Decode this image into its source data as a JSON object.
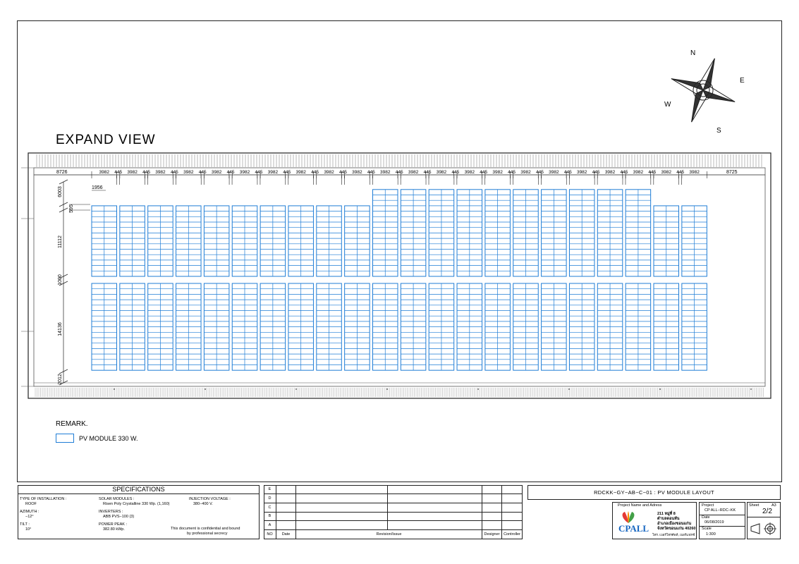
{
  "view_title": "EXPAND VIEW",
  "compass": {
    "n": "N",
    "e": "E",
    "s": "S",
    "w": "W"
  },
  "top_dims": {
    "edge_left": "8726",
    "edge_right": "8725",
    "row_width": "3982",
    "gap": "445",
    "row_count": 22
  },
  "left_dims": {
    "d1": "6003",
    "d2": "595",
    "d3": "11112",
    "d4": "1000",
    "d5": "14136",
    "d6": "2012",
    "module_width": "1956"
  },
  "layout": {
    "upper_tall_rows": [
      10,
      11,
      12,
      13,
      14,
      15,
      16,
      17,
      18,
      19
    ],
    "upper_rows_normal": 13,
    "upper_rows_tall": 16,
    "lower_rows": 16
  },
  "colors": {
    "module": "#1f7dd6",
    "line": "#222222"
  },
  "remark": {
    "title": "REMARK.",
    "legend_label": "PV MODULE 330 W."
  },
  "specs": {
    "heading": "SPECIFICATIONS",
    "type_label": "TYPE OF INSTALLATION :",
    "type_value": "ROOF",
    "azimuth_label": "AZIMUTH :",
    "azimuth_value": "−12°",
    "tilt_label": "TILT :",
    "tilt_value": "10°",
    "modules_label": "SOLAR MODULES :",
    "modules_value": "Risen Poly Crystalline 330 Wp. (1,160)",
    "inverters_label": "INVERTERS :",
    "inverters_value": "ABB PVS−100 (3)",
    "peak_label": "POWER PEAK :",
    "peak_value": "382.80 kWp.",
    "injection_label": "INJECTION VOLTAGE :",
    "injection_value": "380−400 V.",
    "confidential": "This document is confidential and bound",
    "confidential2": "by professional secrecy"
  },
  "revision": {
    "rows": [
      "E",
      "D",
      "C",
      "B",
      "A"
    ],
    "headers": {
      "no": "NO",
      "date": "Date",
      "issue": "Revision/Issue",
      "designer": "Designer",
      "controller": "Controller"
    }
  },
  "drawing_title": "RDCKK−GY−AB−C−01 : PV MODULE LAYOUT",
  "project": {
    "name_label": "Project Name and Adress",
    "logo": "CPALL",
    "address1": "211 หมู่ที่ 8",
    "address2": "ตำบลดอนหัน",
    "address3": "อำเภอเมืองขอนแก่น",
    "address4": "จังหวัดขอนแก่น 40260",
    "address5": "โทร. เบอร์โทรศัพท์, เบอร์แฟกซ์",
    "project_label": "Project",
    "project_value": "CP ALL−RDC−KK",
    "date_label": "Date",
    "date_value": "06/08/2019",
    "scale_label": "Scale",
    "scale_value": "1:300",
    "sheet_label": "Sheet",
    "sheet_size": "A3",
    "sheet_value": "2/2"
  }
}
